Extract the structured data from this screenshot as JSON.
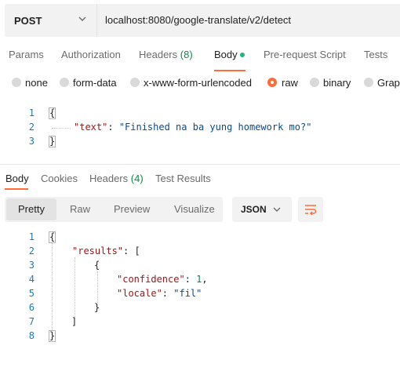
{
  "request": {
    "method": "POST",
    "url": "localhost:8080/google-translate/v2/detect"
  },
  "request_tabs": {
    "params": "Params",
    "authorization": "Authorization",
    "headers": "Headers",
    "headers_count": "(8)",
    "body": "Body",
    "prerequest": "Pre-request Script",
    "tests": "Tests"
  },
  "body_types": [
    "none",
    "form-data",
    "x-www-form-urlencoded",
    "raw",
    "binary",
    "GraphQL"
  ],
  "body_type_selected": "raw",
  "request_body": {
    "line_numbers": [
      "1",
      "2",
      "3"
    ],
    "open": "{",
    "key": "\"text\"",
    "colon": ": ",
    "value": "\"Finished na ba yung homework mo?\"",
    "close": "}"
  },
  "response_tabs": {
    "body": "Body",
    "cookies": "Cookies",
    "headers": "Headers",
    "headers_count": "(4)",
    "test_results": "Test Results"
  },
  "view_modes": [
    "Pretty",
    "Raw",
    "Preview",
    "Visualize"
  ],
  "format": "JSON",
  "response_body": {
    "line_numbers": [
      "1",
      "2",
      "3",
      "4",
      "5",
      "6",
      "7",
      "8"
    ],
    "l1": "{",
    "results_key": "\"results\"",
    "results_rest": ": [",
    "l3": "{",
    "confidence_key": "\"confidence\"",
    "confidence_colon": ": ",
    "confidence_value": "1",
    "confidence_comma": ",",
    "locale_key": "\"locale\"",
    "locale_colon": ": ",
    "locale_value": "\"fil\"",
    "l6": "}",
    "l7": "]",
    "l8": "}"
  },
  "colors": {
    "accent": "#ff6c37",
    "green_dot": "#26b47f",
    "line_number": "#1d7ab8"
  }
}
